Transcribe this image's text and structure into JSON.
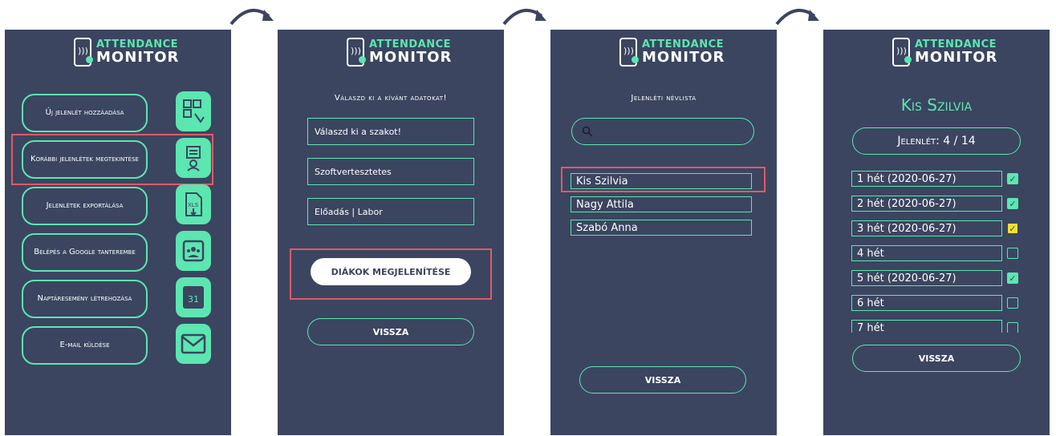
{
  "logo": {
    "line1": "ATTENDANCE",
    "line2": "MONITOR"
  },
  "colors": {
    "background": "#3b4560",
    "accent": "#5ce6b0",
    "highlight": "#e05a66",
    "checked_yellow": "#f2e033"
  },
  "screen1": {
    "menu": [
      {
        "label": "Új jelenlét hozzáadása",
        "icon": "qr-scan-icon"
      },
      {
        "label": "Korábbi jelenlétek megtekintése",
        "icon": "attendance-list-icon"
      },
      {
        "label": "Jelenlétek exportálása",
        "icon": "export-xls-icon"
      },
      {
        "label": "Belépés a Google tanterembe",
        "icon": "google-classroom-icon"
      },
      {
        "label": "Naptáresemény létrehozása",
        "icon": "calendar-icon",
        "icon_text": "31"
      },
      {
        "label": "E-mail küldése",
        "icon": "envelope-icon"
      }
    ]
  },
  "screen2": {
    "caption": "Válaszd ki a kívánt adatokat!",
    "fields": [
      "Válaszd ki a szakot!",
      "Szoftvertesztetes",
      "Előadás | Labor"
    ],
    "show_button": "DIÁKOK MEGJELENÍTÉSE",
    "back_button": "VISSZA"
  },
  "screen3": {
    "caption": "Jelenléti névlista",
    "search_placeholder": "",
    "names": [
      "Kis Szilvia",
      "Nagy Attila",
      "Szabó Anna"
    ],
    "back_button": "VISSZA"
  },
  "screen4": {
    "student_name": "Kis Szilvia",
    "attendance": "Jelenlét: 4 / 14",
    "weeks": [
      {
        "label": "1 hét (2020-06-27)",
        "state": "on"
      },
      {
        "label": "2 hét (2020-06-27)",
        "state": "on"
      },
      {
        "label": "3 hét (2020-06-27)",
        "state": "yel"
      },
      {
        "label": "4 hét",
        "state": "off"
      },
      {
        "label": "5 hét (2020-06-27)",
        "state": "on"
      },
      {
        "label": "6 hét",
        "state": "off"
      },
      {
        "label": "7 hét",
        "state": "off"
      }
    ],
    "back_button": "VISSZA"
  }
}
